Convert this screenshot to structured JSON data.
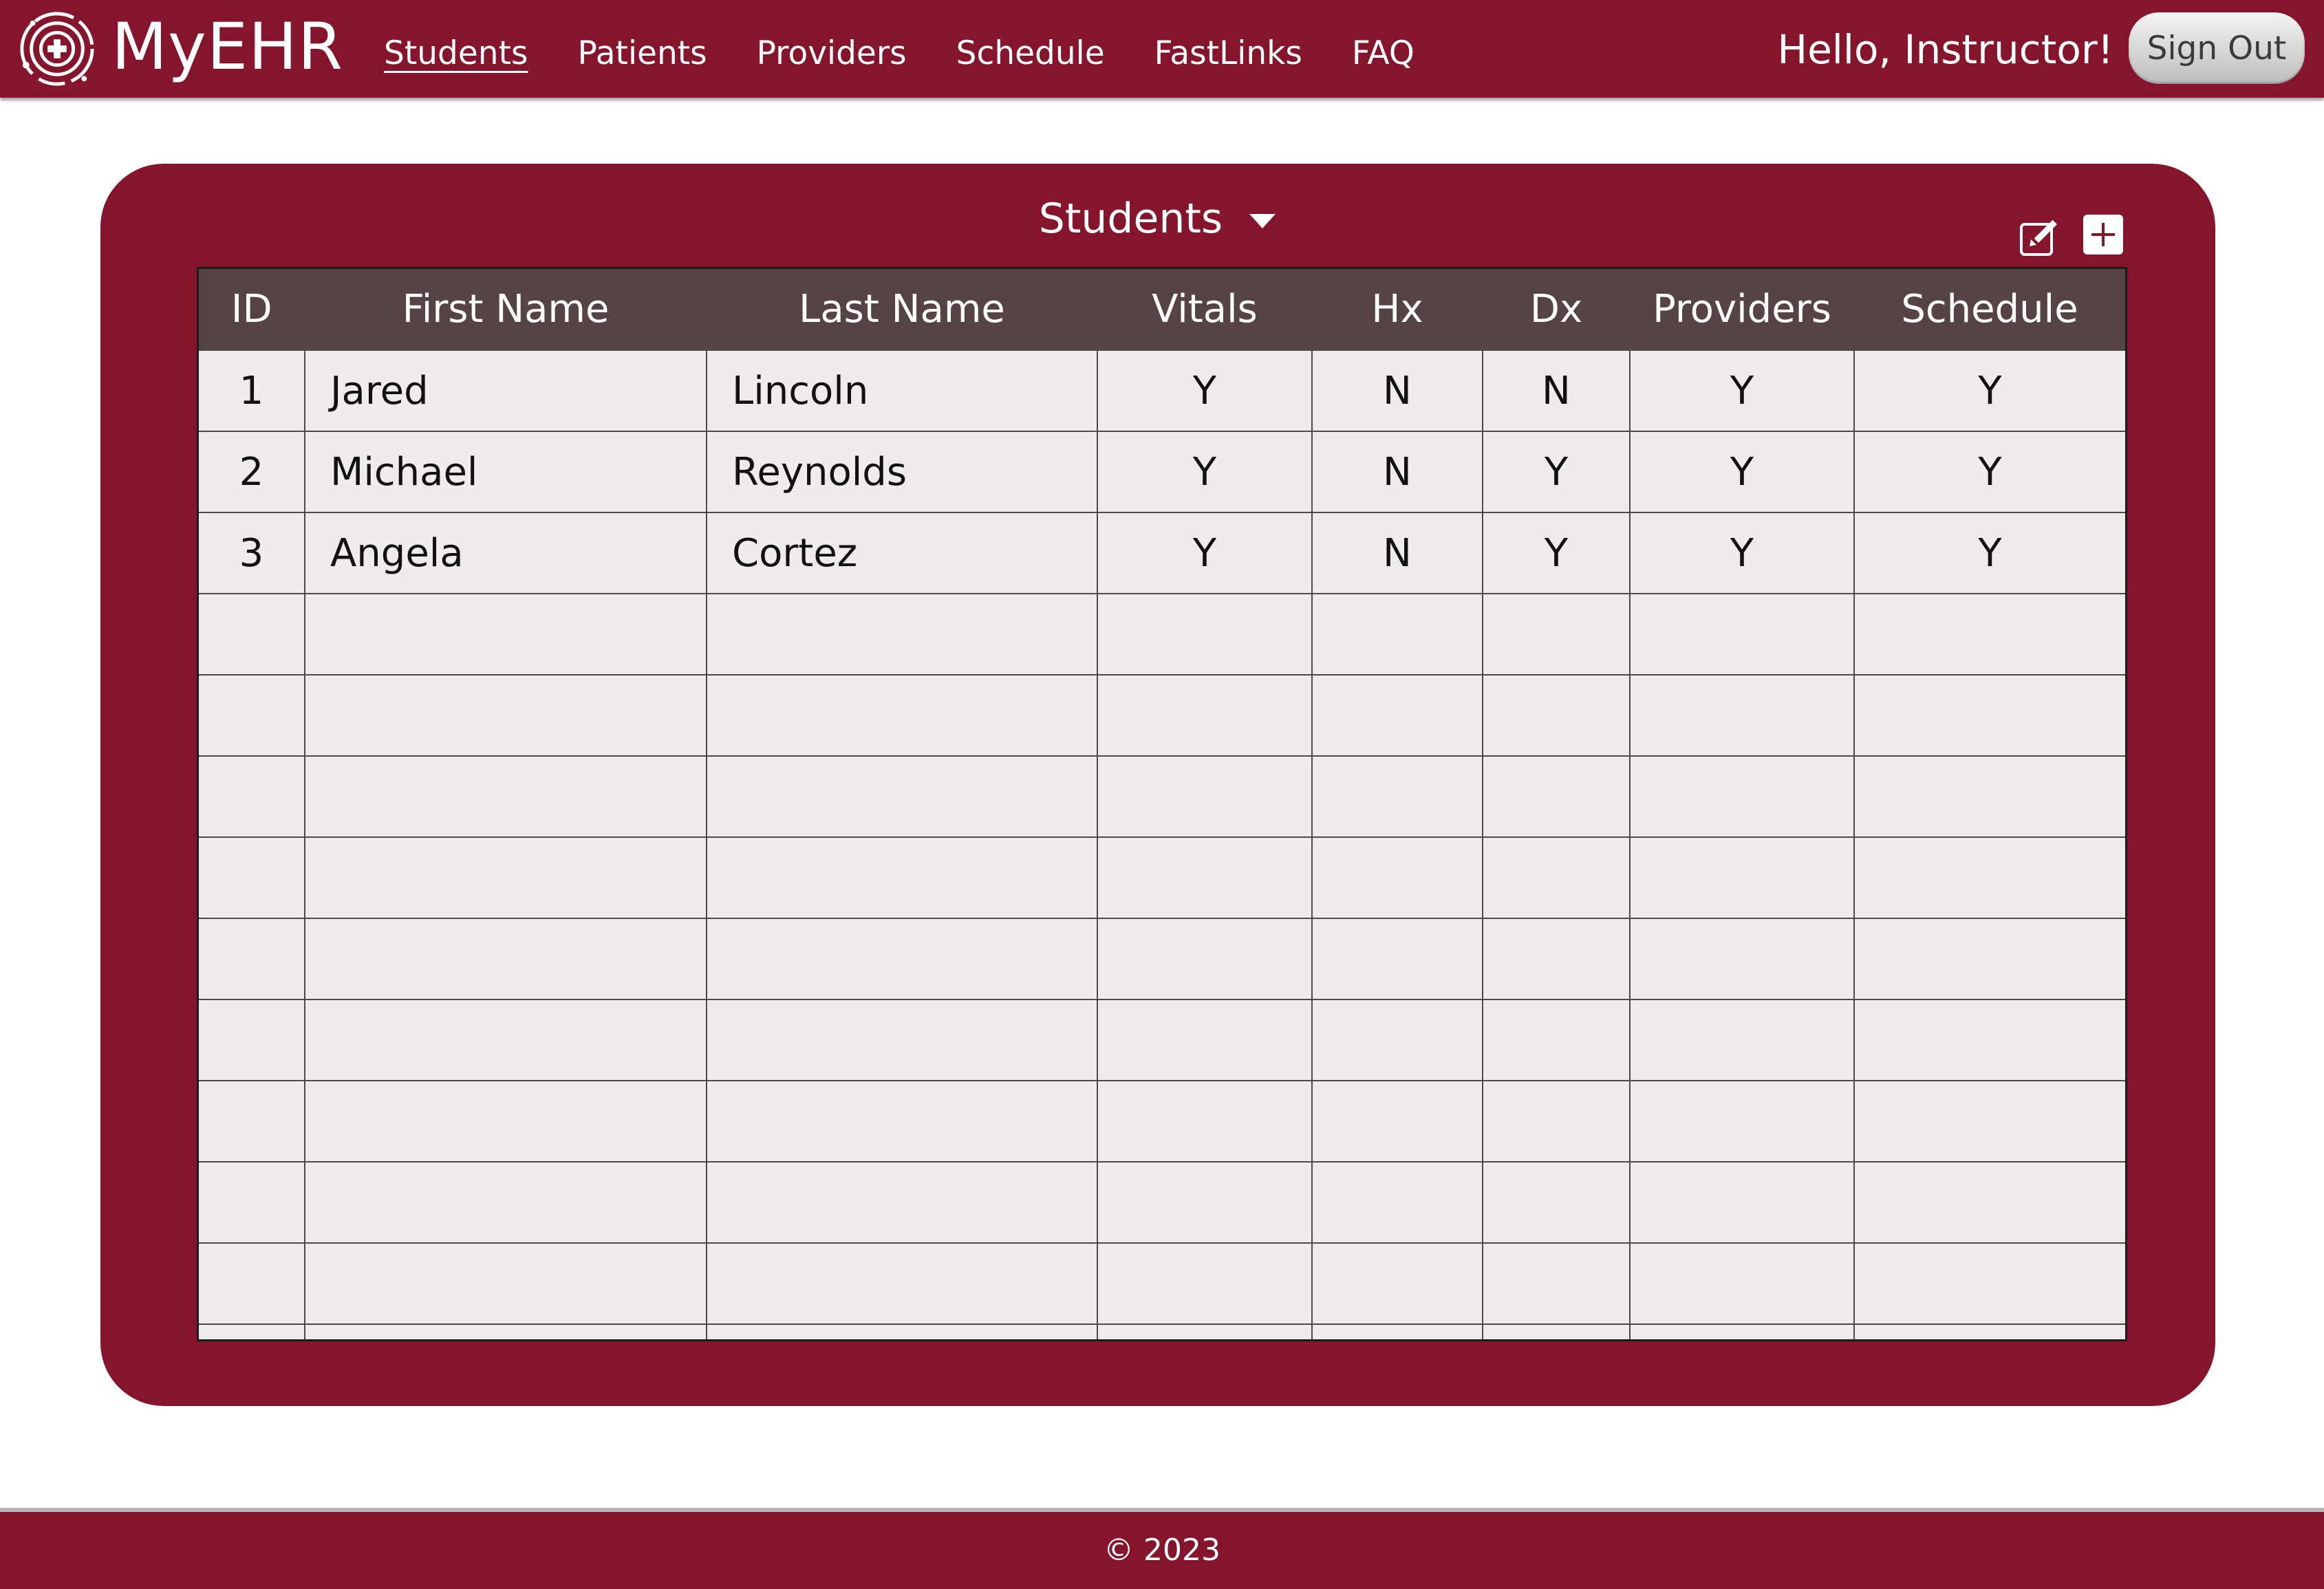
{
  "app": {
    "brand": "MyEHR",
    "logo_icon": "medical-cross-circle-icon"
  },
  "nav": {
    "items": [
      {
        "label": "Students",
        "active": true
      },
      {
        "label": "Patients",
        "active": false
      },
      {
        "label": "Providers",
        "active": false
      },
      {
        "label": "Schedule",
        "active": false
      },
      {
        "label": "FastLinks",
        "active": false
      },
      {
        "label": "FAQ",
        "active": false
      }
    ],
    "greeting": "Hello, Instructor!",
    "sign_out_label": "Sign Out"
  },
  "panel": {
    "title": "Students",
    "title_icon": "caret-down-icon",
    "tools": {
      "edit_icon": "edit-icon",
      "add_icon": "plus-icon"
    }
  },
  "table": {
    "columns": [
      "ID",
      "First Name",
      "Last Name",
      "Vitals",
      "Hx",
      "Dx",
      "Providers",
      "Schedule"
    ],
    "rows": [
      [
        "1",
        "Jared",
        "Lincoln",
        "Y",
        "N",
        "N",
        "Y",
        "Y"
      ],
      [
        "2",
        "Michael",
        "Reynolds",
        "Y",
        "N",
        "Y",
        "Y",
        "Y"
      ],
      [
        "3",
        "Angela",
        "Cortez",
        "Y",
        "N",
        "Y",
        "Y",
        "Y"
      ]
    ],
    "empty_rows": 10
  },
  "footer": {
    "text": "© 2023"
  },
  "colors": {
    "brand": "#84152d",
    "header_row": "#564346",
    "row_bg": "#f1ecec",
    "sign_out_bg": "#d6d6d6"
  }
}
